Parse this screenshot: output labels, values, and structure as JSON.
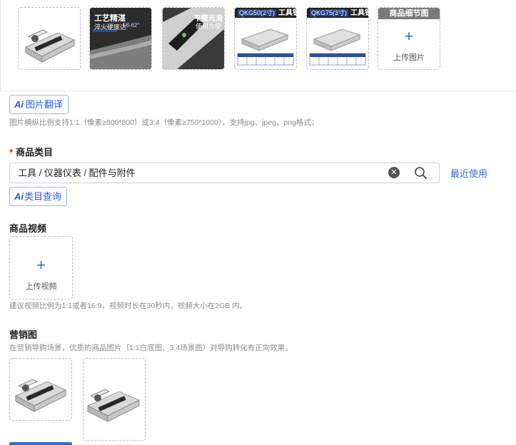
{
  "main_images": {
    "items": [
      {
        "icon": "vise-product-image"
      },
      {
        "title": "工艺精湛",
        "subtitle": "淬火硬度达",
        "badge": "58-62°"
      },
      {
        "title": "平整光滑",
        "subtitle": "使用方便"
      },
      {
        "model": "QKG50(2寸)",
        "tag": "工具钢"
      },
      {
        "model": "QKG75(3寸)",
        "tag": "工具钢"
      }
    ],
    "detail_upload": {
      "header": "商品细节图",
      "plus": "+",
      "label": "上传图片"
    }
  },
  "image_translate": {
    "ai": "Ai",
    "label": "图片翻译"
  },
  "image_hint": "图片横纵比例支持1:1（像素≥800*800）或3:4（像素≥750*1000），支持jpg、jpeg、png格式；",
  "category": {
    "required_mark": "*",
    "label": "商品类目",
    "value": "工具 / 仪器仪表 / 配件与附件",
    "clear_icon": "close-circle-icon",
    "search_icon": "search-icon",
    "recent_link": "最近使用",
    "ai_query": {
      "ai": "Ai",
      "label": "类目查询"
    }
  },
  "video": {
    "label": "商品视频",
    "plus": "+",
    "upload_label": "上传视频",
    "hint": "建议视频比例为1:1或者16:9，视频时长在30秒内，视频大小在2GB 内。"
  },
  "marketing": {
    "label": "营销图",
    "hint": "在营销导购场景，优质的商品图片（1:1白底图、3:4场景图）对导购转化有正向效果。"
  },
  "colors": {
    "accent": "#2d6fd6",
    "required": "#e02020",
    "border": "#bdbdbd",
    "hint": "#8a8a8a"
  }
}
